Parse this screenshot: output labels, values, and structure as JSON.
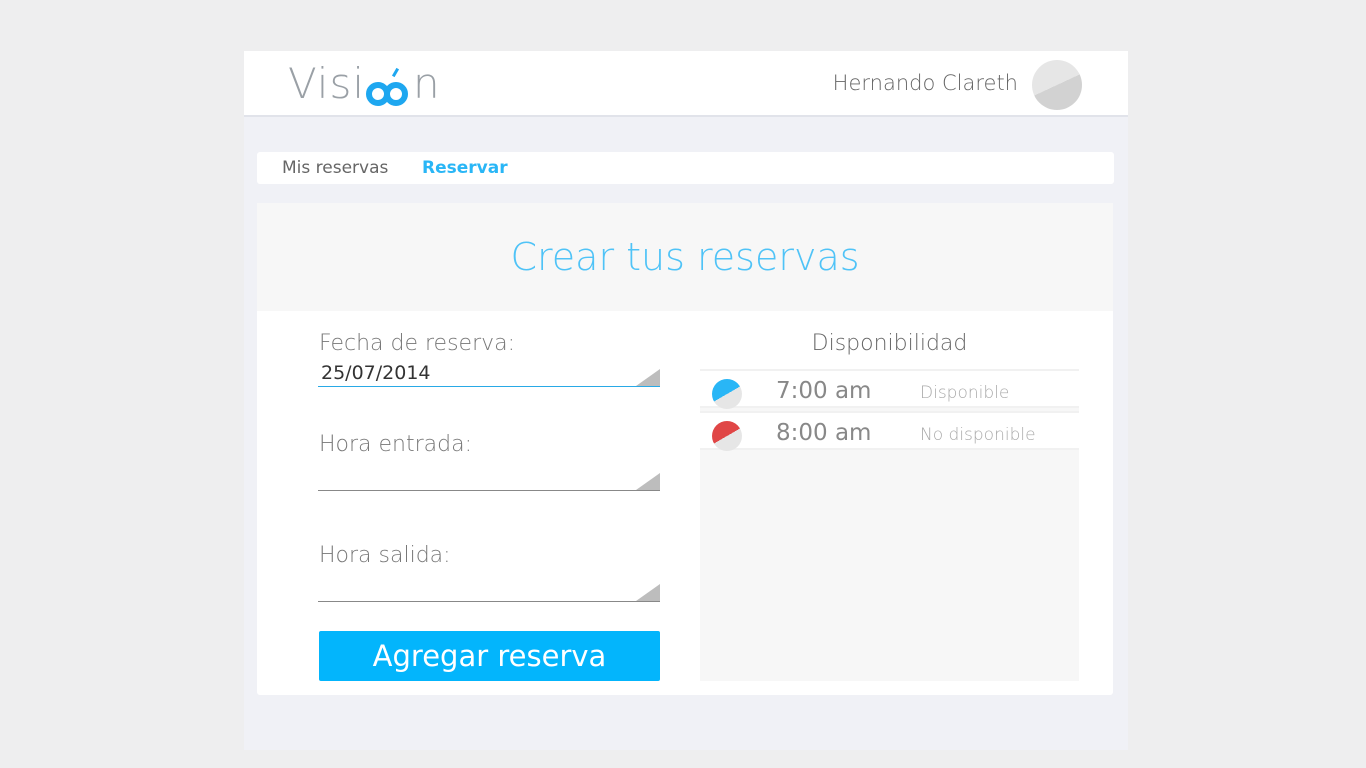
{
  "header": {
    "logo_prefix": "Visi",
    "logo_suffix": "n",
    "user_name": "Hernando Clareth"
  },
  "tabs": [
    {
      "label": "Mis reservas",
      "active": false
    },
    {
      "label": "Reservar",
      "active": true
    }
  ],
  "form": {
    "title": "Crear tus reservas",
    "fecha_label": "Fecha de reserva:",
    "fecha_value": "25/07/2014",
    "hora_entrada_label": "Hora entrada:",
    "hora_entrada_value": "",
    "hora_salida_label": "Hora salida:",
    "hora_salida_value": "",
    "submit_label": "Agregar reserva"
  },
  "availability": {
    "title": "Disponibilidad",
    "slots": [
      {
        "time": "7:00 am",
        "status": "Disponible",
        "status_color": "#29b6f6"
      },
      {
        "time": "8:00 am",
        "status": "No disponible",
        "status_color": "#e04646"
      }
    ]
  },
  "colors": {
    "accent": "#03b5fc",
    "available": "#29b6f6",
    "unavailable": "#e04646"
  }
}
